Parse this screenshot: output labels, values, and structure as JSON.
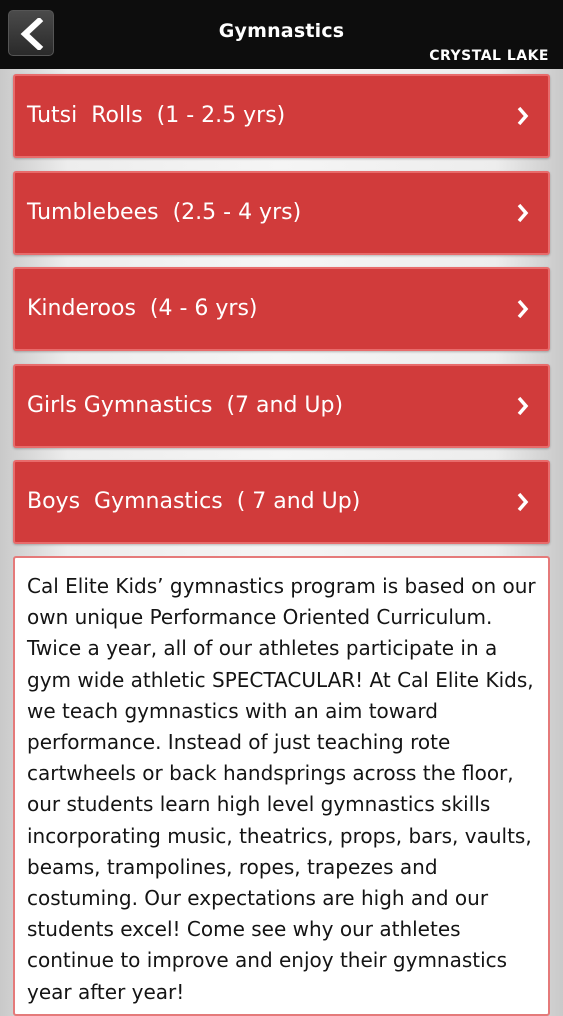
{
  "header": {
    "title": "Gymnastics",
    "location": "CRYSTAL LAKE",
    "back_icon": "chevron-left-icon"
  },
  "programs": [
    {
      "label": "Tutsi  Rolls  (1 - 2.5 yrs)",
      "icon": "chevron-right-icon"
    },
    {
      "label": "Tumblebees  (2.5 - 4 yrs)",
      "icon": "chevron-right-icon"
    },
    {
      "label": "Kinderoos  (4 - 6 yrs)",
      "icon": "chevron-right-icon"
    },
    {
      "label": "Girls Gymnastics  (7 and Up)",
      "icon": "chevron-right-icon"
    },
    {
      "label": "Boys  Gymnastics  ( 7 and Up)",
      "icon": "chevron-right-icon"
    }
  ],
  "description": "Cal Elite Kids’ gymnastics program is based on our own unique Performance Oriented Curriculum. Twice a year, all of our athletes participate in a gym wide athletic SPECTACULAR! At Cal Elite Kids, we teach gymnastics with an aim toward performance. Instead of just teaching rote cartwheels or back handsprings across the floor, our students learn high level gymnastics skills incorporating music, theatrics, props, bars, vaults, beams, trampolines, ropes, trapezes and costuming. Our expectations are high and our students excel! Come see why our athletes continue to improve and enjoy their gymnastics year after year!",
  "colors": {
    "header_bg": "#0d0d0d",
    "button_red": "#d13b3b",
    "button_border": "#e86b6b",
    "text_white": "#ffffff"
  }
}
